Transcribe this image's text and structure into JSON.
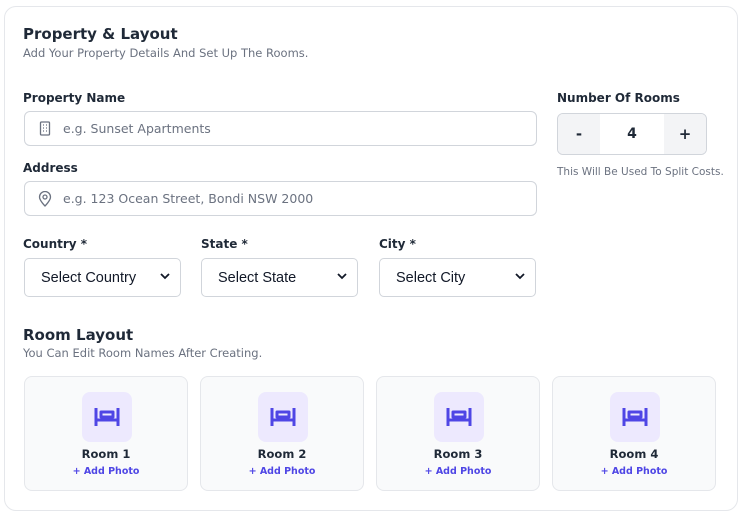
{
  "section": {
    "title": "Property & Layout",
    "subtitle": "Add Your Property Details And Set Up The Rooms."
  },
  "property_name": {
    "label": "Property Name",
    "placeholder": "e.g. Sunset Apartments",
    "icon": "building-icon"
  },
  "address": {
    "label": "Address",
    "placeholder": "e.g. 123 Ocean Street, Bondi NSW 2000",
    "icon": "map-pin-icon"
  },
  "rooms_count": {
    "label": "Number Of Rooms",
    "decrement": "-",
    "value": "4",
    "increment": "+",
    "hint": "This Will Be Used To Split Costs."
  },
  "country": {
    "label": "Country *",
    "selected": "Select Country"
  },
  "state": {
    "label": "State *",
    "selected": "Select State"
  },
  "city": {
    "label": "City *",
    "selected": "Select City"
  },
  "room_layout": {
    "title": "Room Layout",
    "subtitle": "You Can Edit Room Names After Creating.",
    "rooms": [
      {
        "name": "Room 1",
        "action": "+ Add Photo"
      },
      {
        "name": "Room 2",
        "action": "+ Add Photo"
      },
      {
        "name": "Room 3",
        "action": "+ Add Photo"
      },
      {
        "name": "Room 4",
        "action": "+ Add Photo"
      }
    ]
  },
  "colors": {
    "accent": "#4f46e5",
    "icon_tile": "#ede9fe",
    "border": "#d1d5db",
    "muted_text": "#6b7280"
  }
}
